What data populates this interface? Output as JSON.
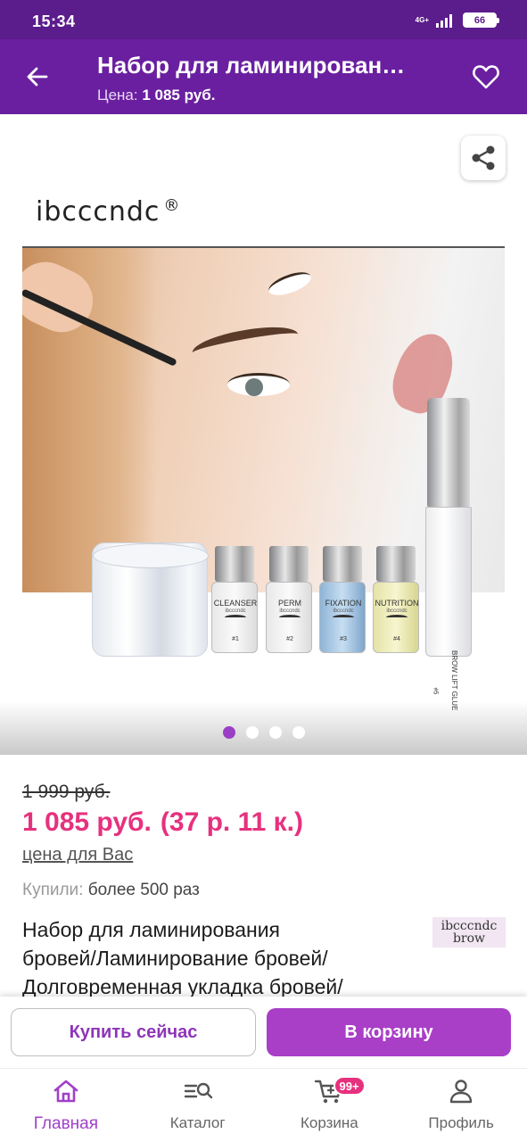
{
  "status_bar": {
    "time": "15:34",
    "network": "4G+",
    "battery": "66"
  },
  "header": {
    "title": "Набор для ламинирован…",
    "price_label": "Цена:",
    "price_value": "1 085 руб.",
    "back_icon": "arrow-left-icon",
    "favorite_icon": "heart-outline-icon"
  },
  "gallery": {
    "brand_logo": "ibcccndc",
    "brand_mark": "®",
    "share_icon": "share-icon",
    "products": [
      "CLEANSER",
      "PERM",
      "FIXATION",
      "NUTRITION"
    ],
    "product_numbers": [
      "#1",
      "#2",
      "#3",
      "#4"
    ],
    "product_sublabel": "ibcccndc",
    "glue_label": "BROW LIFT GLUE",
    "glue_number": "#5",
    "page_count": 4,
    "active_page": 1
  },
  "pricing": {
    "old_price": "1 999 руб.",
    "price": "1 085 руб.",
    "installment": "(37 р. 11 к.)",
    "price_note": "цена для Вас"
  },
  "stats": {
    "bought_label": "Купили:",
    "bought_value": "более 500 раз"
  },
  "product": {
    "title_line1": "Набор для ламинирования",
    "title_line2": "бровей/Ламинирование бровей/",
    "title_line3": "Долговременная укладка бровей/",
    "seller_logo_line1": "ibcccndc",
    "seller_logo_line2": "brow"
  },
  "actions": {
    "buy_now": "Купить сейчас",
    "add_to_cart": "В корзину"
  },
  "bottom_nav": {
    "items": [
      {
        "label": "Главная",
        "icon": "home-icon",
        "active": true
      },
      {
        "label": "Каталог",
        "icon": "catalog-search-icon",
        "active": false
      },
      {
        "label": "Корзина",
        "icon": "cart-icon",
        "active": false,
        "badge": "99+"
      },
      {
        "label": "Профиль",
        "icon": "profile-icon",
        "active": false
      }
    ]
  },
  "colors": {
    "header_bg": "#6a1fa0",
    "accent": "#a93ec7",
    "price": "#e6317e"
  }
}
